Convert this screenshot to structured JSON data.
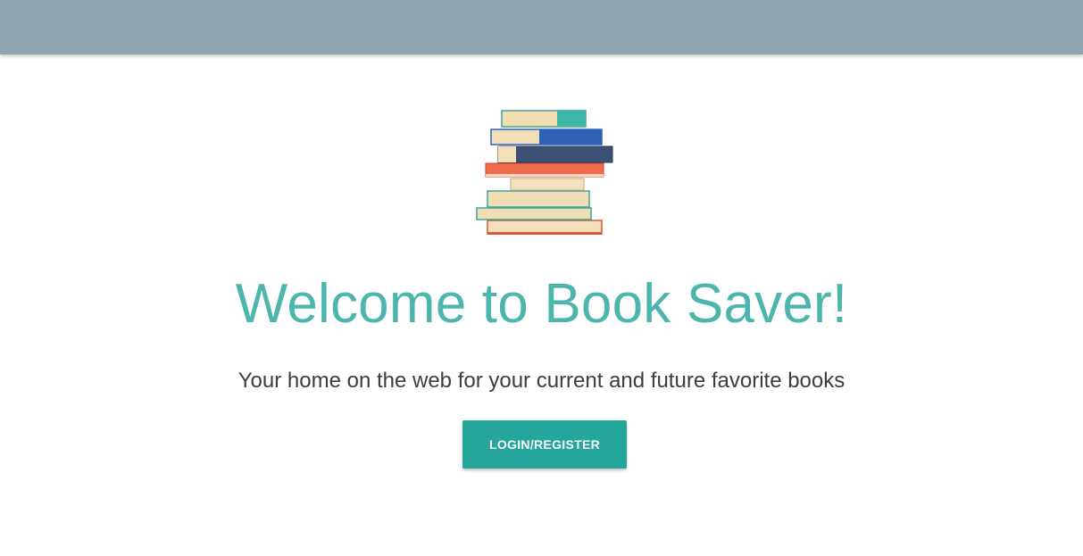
{
  "header": {
    "background_color": "#90a4ae"
  },
  "hero": {
    "image_icon": "book-stack-icon",
    "title": "Welcome to Book Saver!",
    "title_color": "#4db6ac",
    "subtitle": "Your home on the web for your current and future favorite books",
    "cta_label": "LOGIN/REGISTER",
    "cta_color": "#26a69a"
  }
}
